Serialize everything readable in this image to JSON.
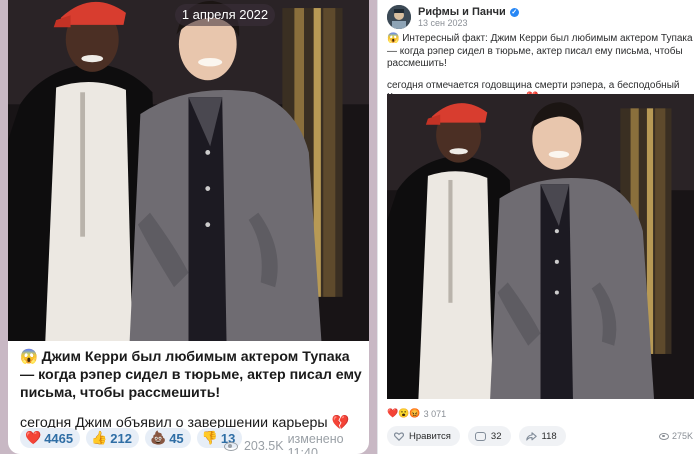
{
  "telegram_post": {
    "date_label": "1 апреля 2022",
    "text_lead": "😱 Джим Керри был любимым актером Тупака — когда рэпер сидел в тюрьме, актер писал ему письма, чтобы рассмешить!",
    "text_body": "сегодня Джим объявил о завершении карьеры 💔",
    "reactions": [
      {
        "emoji": "❤️",
        "count": "4465"
      },
      {
        "emoji": "👍",
        "count": "212"
      },
      {
        "emoji": "💩",
        "count": "45"
      },
      {
        "emoji": "👎",
        "count": "13"
      }
    ],
    "views": "203.5K",
    "edited_time": "изменено 11:40"
  },
  "vk_post": {
    "channel_name": "Рифмы и Панчи",
    "post_date": "13 сен 2023",
    "text_lead": "😱 Интересный факт: Джим Керри был любимым актером Тупака — когда рэпер сидел в тюрьме, актер писал ему письма, чтобы рассмешить!",
    "text_body": "сегодня отмечается годовщина смерти рэпера, а бесподобный Керри уже завершил карьеру 💔",
    "reactions_emoji": "❤️😮😡",
    "reactions_count": "3 071",
    "like_label": "Нравится",
    "comments_count": "32",
    "shares_count": "118",
    "views": "275K"
  },
  "colors": {
    "telegram_accent": "#2f6ea5",
    "vk_accent": "#2787f5",
    "chat_background": "#c8b8c4"
  }
}
